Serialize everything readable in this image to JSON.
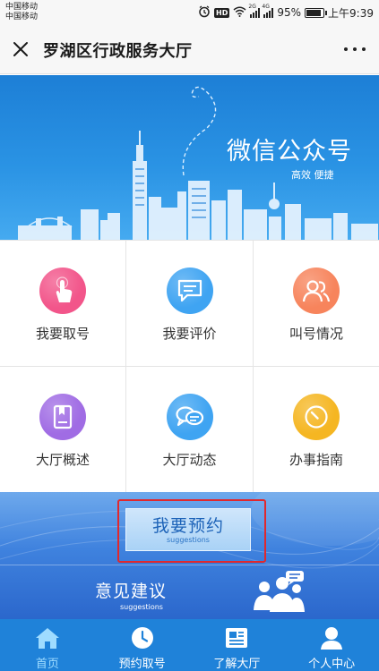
{
  "status_bar": {
    "carrier_1": "中国移动",
    "carrier_2": "中国移动",
    "hd": "HD",
    "net_1": "2G",
    "net_2": "4G",
    "battery_percent": "95%",
    "battery_level": 0.95,
    "time": "上午9:39"
  },
  "title_bar": {
    "title": "罗湖区行政服务大厅"
  },
  "banner": {
    "title": "微信公众号",
    "subtitle": "高效 便捷"
  },
  "grid": {
    "items": [
      {
        "label": "我要取号",
        "icon": "hand-tap-icon",
        "color": "#f2558a"
      },
      {
        "label": "我要评价",
        "icon": "chat-list-icon",
        "color": "#3fa4f2"
      },
      {
        "label": "叫号情况",
        "icon": "people-icon",
        "color": "#f7845c"
      },
      {
        "label": "大厅概述",
        "icon": "bookmark-book-icon",
        "color": "#a06ce4"
      },
      {
        "label": "大厅动态",
        "icon": "chat-bubbles-icon",
        "color": "#3fa4f2"
      },
      {
        "label": "办事指南",
        "icon": "compass-icon",
        "color": "#f5b622"
      }
    ]
  },
  "appointment": {
    "main": "我要预约",
    "sub": "suggestions"
  },
  "suggestions": {
    "main": "意见建议",
    "sub": "suggestions"
  },
  "tab_bar": {
    "items": [
      {
        "label": "首页",
        "icon": "home-icon",
        "active": true
      },
      {
        "label": "预约取号",
        "icon": "clock-icon",
        "active": false
      },
      {
        "label": "了解大厅",
        "icon": "newspaper-icon",
        "active": false
      },
      {
        "label": "个人中心",
        "icon": "user-icon",
        "active": false
      }
    ]
  },
  "colors": {
    "banner_blue": "#2a93e4",
    "tab_bar_blue": "#1f82d9",
    "active_tab": "#9fdcff",
    "highlight_red": "#e0282d"
  }
}
